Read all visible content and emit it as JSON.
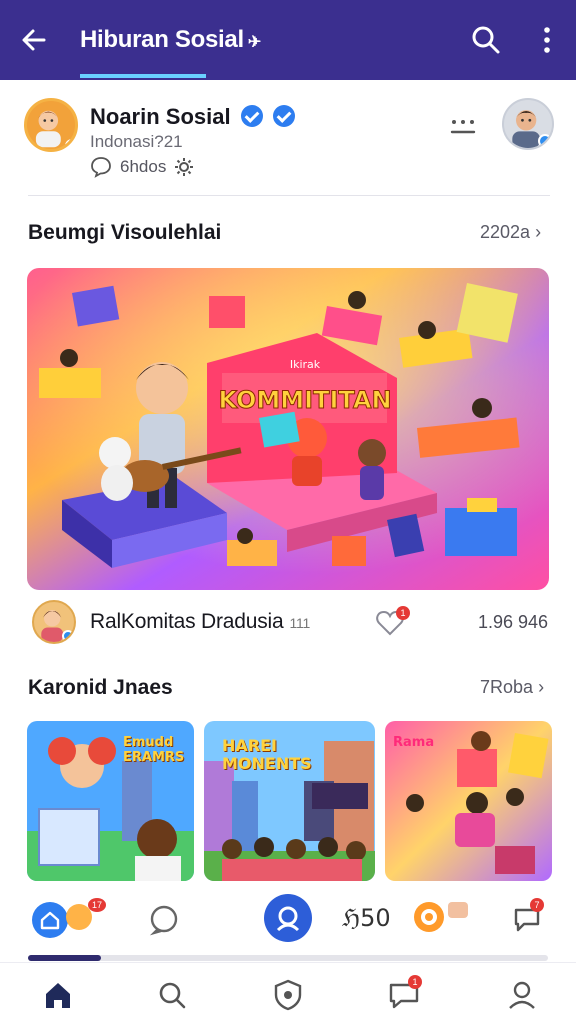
{
  "app_bar": {
    "title": "Hiburan Sosial",
    "title_glyph": "✈",
    "icons": [
      "back-arrow-icon",
      "search-icon",
      "more-vertical-icon"
    ]
  },
  "profile": {
    "name": "Noarin Sosial",
    "handle": "Indonasi?21",
    "meta_text": "6hdos",
    "icons": [
      "comment-icon",
      "settings-icon",
      "dots-icon",
      "verified-icon"
    ]
  },
  "section_featured": {
    "title": "Beumgi Visoulehlai",
    "link": "2202a"
  },
  "hero": {
    "banner_small": "Ikirak",
    "banner_text": "KOMMITITAN"
  },
  "post": {
    "name": "RalKomitas Dradusia",
    "suffix": "111",
    "count": "1.96 946",
    "badge": "1"
  },
  "section_cards": {
    "title": "Karonid Jnaes",
    "link": "7Roba"
  },
  "cards": [
    {
      "caption": "Emudd ERAMRS"
    },
    {
      "caption": "HAREI MONENTS"
    },
    {
      "caption": "Rama"
    }
  ],
  "icon_row": {
    "badge_left": "17",
    "center_label": "50",
    "badge_right": "7"
  },
  "progress": {
    "fraction": 0.14
  },
  "bottom_nav": {
    "items": [
      "home-icon",
      "search-icon",
      "shield-icon",
      "chat-icon",
      "profile-icon"
    ],
    "chat_badge": "1"
  },
  "colors": {
    "appbar": "#3b2f8f",
    "accent": "#2d7df0",
    "badge": "#e53935"
  }
}
